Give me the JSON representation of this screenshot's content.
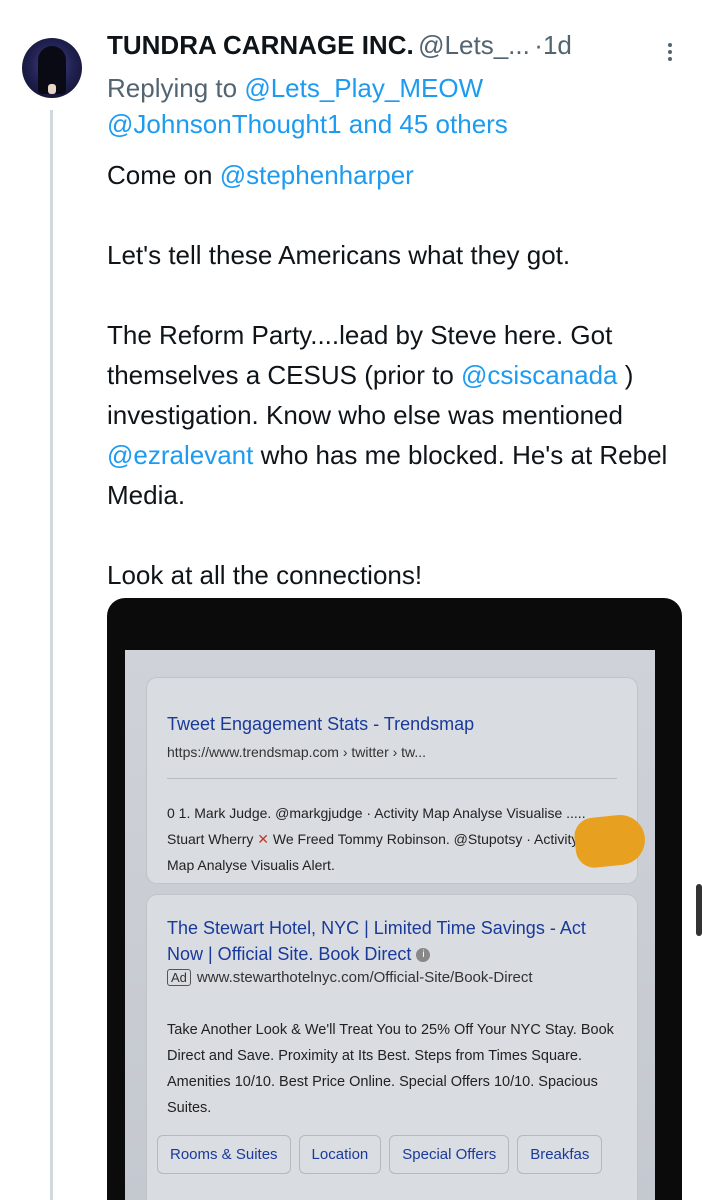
{
  "tweet": {
    "author_name": "TUNDRA CARNAGE INC.",
    "handle": "@Lets_...",
    "dot": "·",
    "time": "1d",
    "replying_prefix": "Replying to",
    "reply_user1": "@Lets_Play_MEOW",
    "reply_user2": "@JohnsonThought1",
    "reply_others": "and 45 others",
    "line1_prefix": "Come on",
    "mention_harper": "@stephenharper",
    "para2": "Let's tell these Americans what they got.",
    "para3_a": "The Reform Party....lead by Steve here. Got themselves a CESUS (prior to",
    "mention_csis": "@csiscanada",
    "para3_b": ") investigation. Know who else was mentioned",
    "mention_ezra": "@ezralevant",
    "para3_c": "who has me blocked. He's at Rebel Media.",
    "para4": "Look at all the connections!"
  },
  "media": {
    "result1": {
      "title": "Tweet Engagement Stats - Trendsmap",
      "url": "https://www.trendsmap.com › twitter › tw...",
      "snippet_a": "0 1. Mark Judge. @markgjudge · Activity Map Analyse Visualise ..... Stuart Wherry",
      "x_mark": "✕",
      "snippet_b": "We Freed Tommy Robinson. @Stupotsy · Activity Map Analyse Visualis Alert."
    },
    "result2": {
      "title": "The Stewart Hotel, NYC | Limited Time Savings - Act Now | Official Site. Book Direct",
      "info": "i",
      "ad_badge": "Ad",
      "ad_url": "www.stewarthotelnyc.com/Official-Site/Book-Direct",
      "snippet": "Take Another Look & We'll Treat You to 25% Off Your NYC Stay. Book Direct and Save. Proximity at Its Best. Steps from Times Square. Amenities 10/10. Best Price Online. Special Offers 10/10. Spacious Suites.",
      "sitelinks": [
        "Rooms & Suites",
        "Location",
        "Special Offers",
        "Breakfas"
      ]
    }
  }
}
